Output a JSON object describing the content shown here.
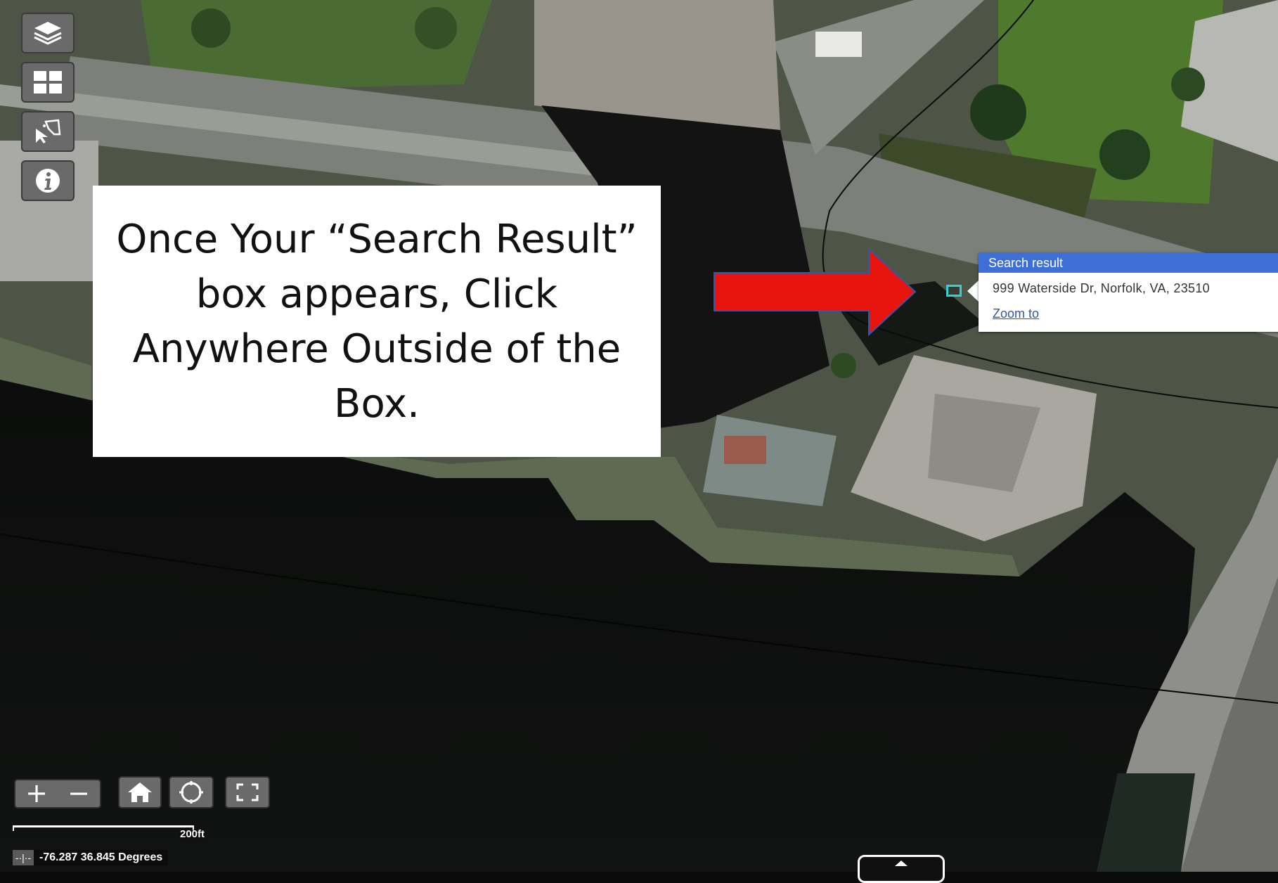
{
  "toolbar": {
    "buttons": [
      {
        "name": "layers",
        "icon": "layers-icon"
      },
      {
        "name": "basemap-gallery",
        "icon": "grid-icon"
      },
      {
        "name": "select",
        "icon": "cursor-select-icon"
      },
      {
        "name": "info",
        "icon": "info-icon"
      }
    ]
  },
  "callout": {
    "text": "Once Your “Search Result” box appears, Click Anywhere Outside of the Box."
  },
  "search_popup": {
    "header": "Search result",
    "address": "999 Waterside Dr, Norfolk, VA, 23510",
    "zoom_link": "Zoom to"
  },
  "map_controls": {
    "zoom_in": "+",
    "zoom_out": "−",
    "home_icon": "home-icon",
    "locate_icon": "locate-icon",
    "fullscreen_icon": "fullscreen-icon"
  },
  "scalebar": {
    "label": "200ft"
  },
  "coordinates": {
    "pin_label": "-·|·-",
    "text": "-76.287 36.845 Degrees"
  },
  "colors": {
    "arrow_red": "#e8150f",
    "popup_header": "#3d6fd6",
    "marker_cyan": "#32d0d8",
    "toolbar_grey": "#6a6a6a"
  }
}
